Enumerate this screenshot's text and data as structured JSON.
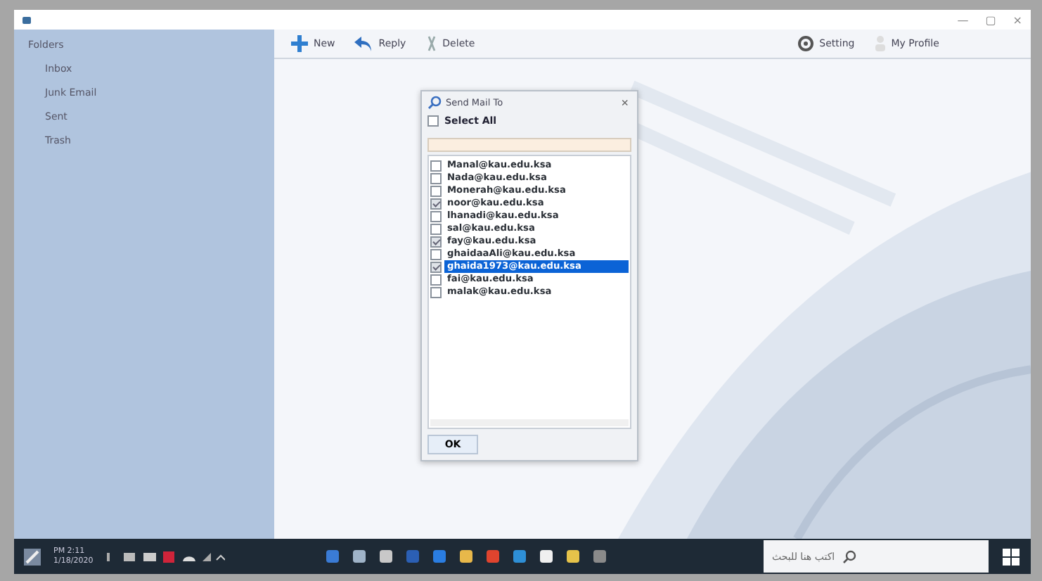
{
  "window": {
    "controls": [
      "—",
      "▢",
      "×"
    ]
  },
  "sidebar": {
    "root": {
      "label": "Folders",
      "children": [
        {
          "label": "Inbox",
          "selected": false
        },
        {
          "label": "Junk Email",
          "selected": false
        },
        {
          "label": "Sent",
          "selected": false
        },
        {
          "label": "Trash",
          "selected": false
        }
      ]
    }
  },
  "toolbar": [
    {
      "kind": "new",
      "label": "New"
    },
    {
      "kind": "reply",
      "label": "Reply"
    },
    {
      "kind": "delete",
      "label": "Delete"
    },
    {
      "kind": "setting",
      "label": "Setting"
    },
    {
      "kind": "profile",
      "label": "My Profile"
    }
  ],
  "dialog": {
    "title": "Send Mail To",
    "close": "×",
    "select_all": {
      "label": "Select All",
      "checked": false
    },
    "recipients": [
      {
        "email": "Manal@kau.edu.ksa",
        "checked": false,
        "selected": false
      },
      {
        "email": "Nada@kau.edu.ksa",
        "checked": false,
        "selected": false
      },
      {
        "email": "Monerah@kau.edu.ksa",
        "checked": false,
        "selected": false
      },
      {
        "email": "noor@kau.edu.ksa",
        "checked": true,
        "selected": false
      },
      {
        "email": "lhanadi@kau.edu.ksa",
        "checked": false,
        "selected": false
      },
      {
        "email": "sal@kau.edu.ksa",
        "checked": false,
        "selected": false
      },
      {
        "email": "fay@kau.edu.ksa",
        "checked": true,
        "selected": false
      },
      {
        "email": "ghaidaaAli@kau.edu.ksa",
        "checked": false,
        "selected": false
      },
      {
        "email": "ghaida1973@kau.edu.ksa",
        "checked": true,
        "selected": true
      },
      {
        "email": "fai@kau.edu.ksa",
        "checked": false,
        "selected": false
      },
      {
        "email": "malak@kau.edu.ksa",
        "checked": false,
        "selected": false
      }
    ],
    "ok": "OK"
  },
  "taskbar": {
    "time": "PM 2:11",
    "date": "1/18/2020",
    "search_placeholder": "اكتب هنا للبحث"
  }
}
